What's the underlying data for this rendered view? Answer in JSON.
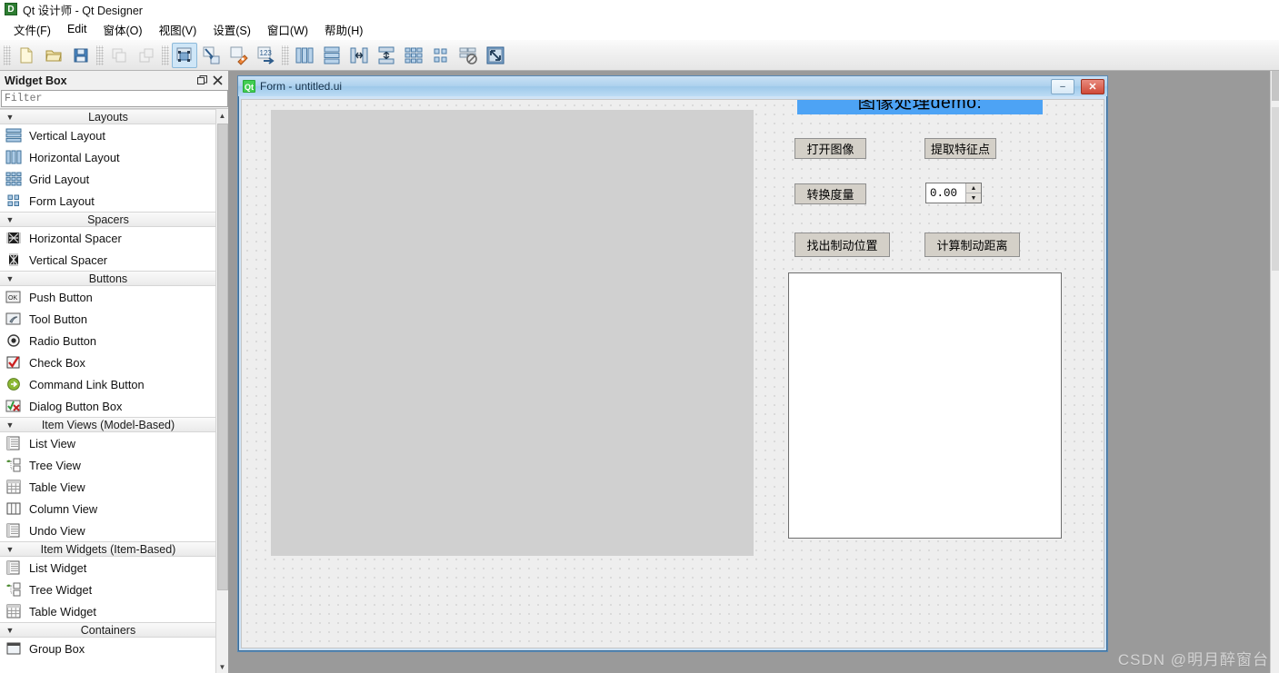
{
  "window": {
    "app_icon": "designer-icon",
    "title": "Qt 设计师 - Qt Designer"
  },
  "menubar": {
    "items": [
      {
        "label": "文件(F)",
        "name": "menu-file"
      },
      {
        "label": "Edit",
        "name": "menu-edit"
      },
      {
        "label": "窗体(O)",
        "name": "menu-form"
      },
      {
        "label": "视图(V)",
        "name": "menu-view"
      },
      {
        "label": "设置(S)",
        "name": "menu-settings"
      },
      {
        "label": "窗口(W)",
        "name": "menu-window"
      },
      {
        "label": "帮助(H)",
        "name": "menu-help"
      }
    ]
  },
  "toolbar": {
    "groups": [
      {
        "buttons": [
          {
            "icon": "new-file-icon",
            "tooltip": "新建"
          },
          {
            "icon": "open-folder-icon",
            "tooltip": "打开"
          },
          {
            "icon": "save-disk-icon",
            "tooltip": "保存"
          }
        ]
      },
      {
        "buttons": [
          {
            "icon": "undo-icon",
            "tooltip": "撤销",
            "state": "disabled"
          },
          {
            "icon": "redo-icon",
            "tooltip": "重做",
            "state": "disabled"
          }
        ]
      },
      {
        "buttons": [
          {
            "icon": "edit-widgets-icon",
            "tooltip": "编辑控件",
            "state": "active"
          },
          {
            "icon": "edit-signals-slots-icon",
            "tooltip": "编辑信号/槽"
          },
          {
            "icon": "edit-buddies-icon",
            "tooltip": "编辑伙伴"
          },
          {
            "icon": "edit-tab-order-icon",
            "tooltip": "编辑 Tab 顺序"
          }
        ]
      },
      {
        "buttons": [
          {
            "icon": "layout-horizontal-icon",
            "tooltip": "水平布局"
          },
          {
            "icon": "layout-vertical-icon",
            "tooltip": "垂直布局"
          },
          {
            "icon": "layout-splitter-h-icon",
            "tooltip": "水平分裂器布局"
          },
          {
            "icon": "layout-splitter-v-icon",
            "tooltip": "垂直分裂器布局"
          },
          {
            "icon": "layout-grid-icon",
            "tooltip": "栅格布局"
          },
          {
            "icon": "layout-form-icon",
            "tooltip": "表单布局"
          },
          {
            "icon": "break-layout-icon",
            "tooltip": "打破布局"
          },
          {
            "icon": "adjust-size-icon",
            "tooltip": "调整大小"
          }
        ]
      }
    ]
  },
  "widget_box": {
    "title": "Widget Box",
    "float_button": "float-icon",
    "close_button": "close-icon",
    "filter_placeholder": "Filter",
    "filter_value": "",
    "categories": [
      {
        "name": "Layouts",
        "label": "Layouts",
        "expanded": true,
        "items": [
          {
            "label": "Vertical Layout",
            "icon": "vertical-layout-icon"
          },
          {
            "label": "Horizontal Layout",
            "icon": "horizontal-layout-icon"
          },
          {
            "label": "Grid Layout",
            "icon": "grid-layout-icon"
          },
          {
            "label": "Form Layout",
            "icon": "form-layout-icon"
          }
        ]
      },
      {
        "name": "Spacers",
        "label": "Spacers",
        "expanded": true,
        "items": [
          {
            "label": "Horizontal Spacer",
            "icon": "horizontal-spacer-icon"
          },
          {
            "label": "Vertical Spacer",
            "icon": "vertical-spacer-icon"
          }
        ]
      },
      {
        "name": "Buttons",
        "label": "Buttons",
        "expanded": true,
        "items": [
          {
            "label": "Push Button",
            "icon": "push-button-icon"
          },
          {
            "label": "Tool Button",
            "icon": "tool-button-icon"
          },
          {
            "label": "Radio Button",
            "icon": "radio-button-icon"
          },
          {
            "label": "Check Box",
            "icon": "check-box-icon"
          },
          {
            "label": "Command Link Button",
            "icon": "command-link-button-icon"
          },
          {
            "label": "Dialog Button Box",
            "icon": "dialog-button-box-icon"
          }
        ]
      },
      {
        "name": "ItemViews",
        "label": "Item Views (Model-Based)",
        "expanded": true,
        "items": [
          {
            "label": "List View",
            "icon": "list-view-icon"
          },
          {
            "label": "Tree View",
            "icon": "tree-view-icon"
          },
          {
            "label": "Table View",
            "icon": "table-view-icon"
          },
          {
            "label": "Column View",
            "icon": "column-view-icon"
          },
          {
            "label": "Undo View",
            "icon": "undo-view-icon"
          }
        ]
      },
      {
        "name": "ItemWidgets",
        "label": "Item Widgets (Item-Based)",
        "expanded": true,
        "items": [
          {
            "label": "List Widget",
            "icon": "list-widget-icon"
          },
          {
            "label": "Tree Widget",
            "icon": "tree-widget-icon"
          },
          {
            "label": "Table Widget",
            "icon": "table-widget-icon"
          }
        ]
      },
      {
        "name": "Containers",
        "label": "Containers",
        "expanded": true,
        "items": [
          {
            "label": "Group Box",
            "icon": "group-box-icon"
          }
        ]
      }
    ]
  },
  "form_window": {
    "icon": "qt-icon",
    "title": "Form - untitled.ui",
    "minimize_label": "–",
    "close_label": "✕",
    "canvas": {
      "image_panel": {
        "name": "image-preview-panel"
      },
      "heading": {
        "text": "图像处理demo:",
        "background": "#4da3f5",
        "color": "#000000"
      },
      "buttons": [
        {
          "label": "打开图像",
          "name": "open-image-button"
        },
        {
          "label": "提取特征点",
          "name": "extract-features-button"
        },
        {
          "label": "转换度量",
          "name": "convert-measure-button"
        },
        {
          "label": "找出制动位置",
          "name": "find-brake-position-button"
        },
        {
          "label": "计算制动距离",
          "name": "calc-brake-distance-button"
        }
      ],
      "spinbox": {
        "value": "0.00",
        "up_arrow": "▲",
        "down_arrow": "▼"
      },
      "output_panel": {
        "name": "output-text-panel"
      }
    }
  },
  "watermark": {
    "text": "CSDN @明月醉窗台"
  }
}
